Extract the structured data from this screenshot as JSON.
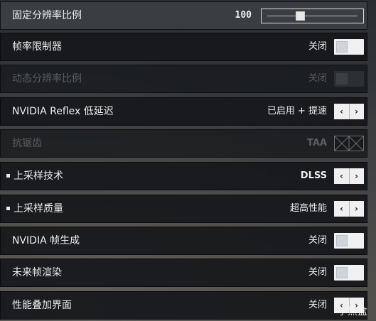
{
  "settings": [
    {
      "label": "固定分辨率比例",
      "value": "100",
      "control": "slider",
      "slider_fraction": 0.35
    },
    {
      "label": "帧率限制器",
      "value": "关闭",
      "control": "toggle"
    },
    {
      "label": "动态分辨率比例",
      "value": "关闭",
      "control": "toggle",
      "disabled": true
    },
    {
      "label": "NVIDIA Reflex 低延迟",
      "value": "已启用 + 提速",
      "control": "arrows"
    },
    {
      "label": "抗锯齿",
      "value": "TAA",
      "control": "none",
      "disabled": true
    },
    {
      "label": "上采样技术",
      "value": "DLSS",
      "control": "arrows"
    },
    {
      "label": "上采样质量",
      "value": "超高性能",
      "control": "arrows"
    },
    {
      "label": "NVIDIA 帧生成",
      "value": "关闭",
      "control": "toggle"
    },
    {
      "label": "未来帧渲染",
      "value": "关闭",
      "control": "toggle"
    },
    {
      "label": "性能叠加界面",
      "value": "关闭",
      "control": "arrows"
    }
  ],
  "controls": {
    "arrow_left": "‹",
    "arrow_right": "›"
  },
  "watermark": "小黑盒"
}
